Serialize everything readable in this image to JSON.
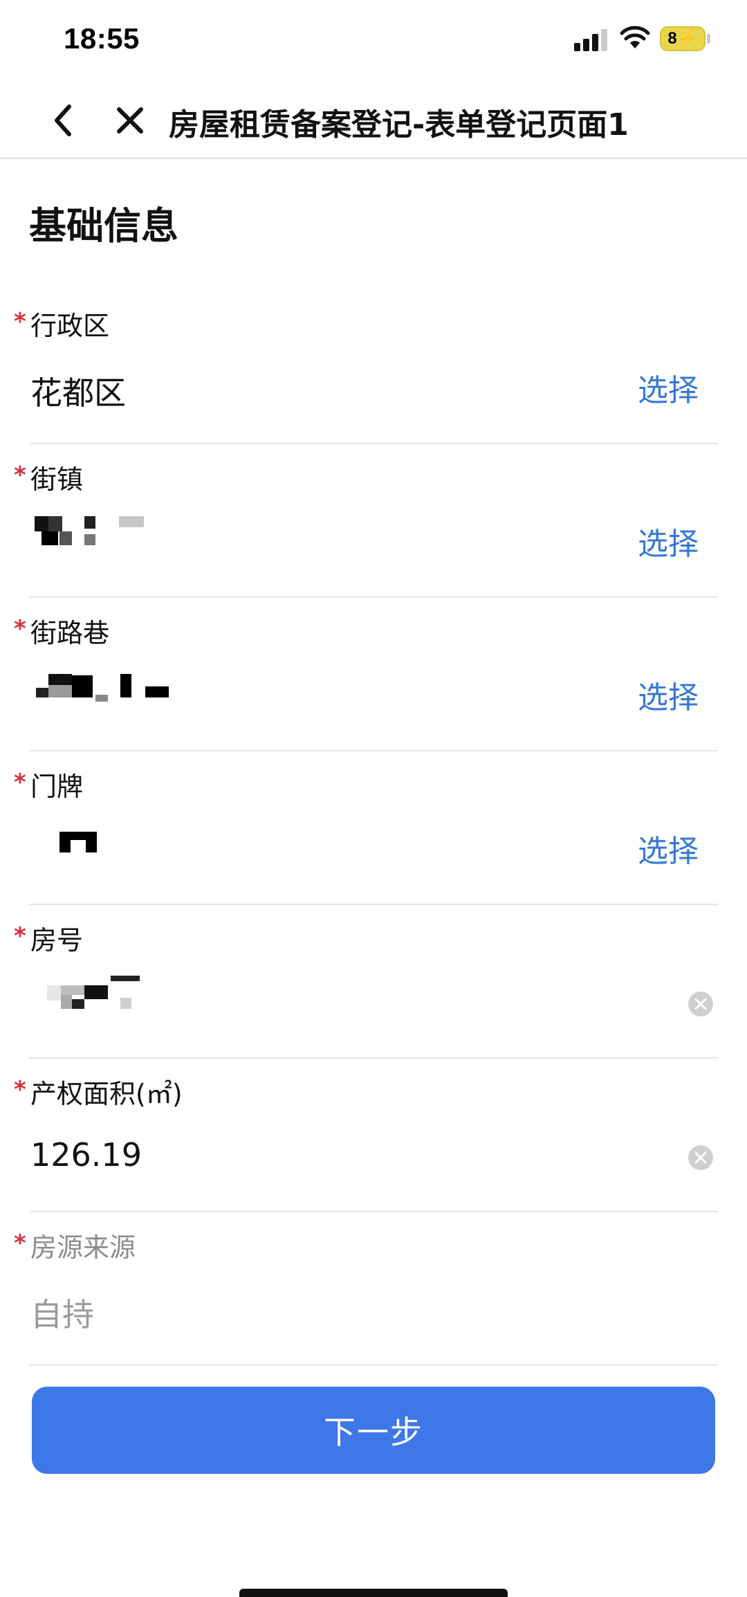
{
  "status_bar": {
    "time": "18:55",
    "battery": "8",
    "icons": [
      "cellular-signal-icon",
      "wifi-icon",
      "battery-charging-icon"
    ]
  },
  "nav": {
    "title": "房屋租赁备案登记-表单登记页面1",
    "icons": [
      "chevron-left-icon",
      "close-icon"
    ]
  },
  "section": {
    "title": "基础信息"
  },
  "fields": [
    {
      "label": "行政区",
      "required": true,
      "value": "花都区",
      "action": "选择"
    },
    {
      "label": "街镇",
      "required": true,
      "value": "",
      "action": "选择"
    },
    {
      "label": "街路巷",
      "required": true,
      "value": "",
      "action": "选择"
    },
    {
      "label": "门牌",
      "required": true,
      "value": "",
      "action": "选择"
    },
    {
      "label": "房号",
      "required": true,
      "value": "",
      "action": "clear"
    },
    {
      "label": "产权面积(㎡)",
      "required": true,
      "value": "126.19",
      "action": "clear"
    },
    {
      "label": "房源来源",
      "required": true,
      "value": "自持",
      "disabled": true
    }
  ],
  "buttons": {
    "next": "下一步"
  },
  "colors": {
    "accent": "#3478d6",
    "primary_button": "#3d77e8",
    "required_star": "#d8323d",
    "divider": "#e6e6e6"
  }
}
